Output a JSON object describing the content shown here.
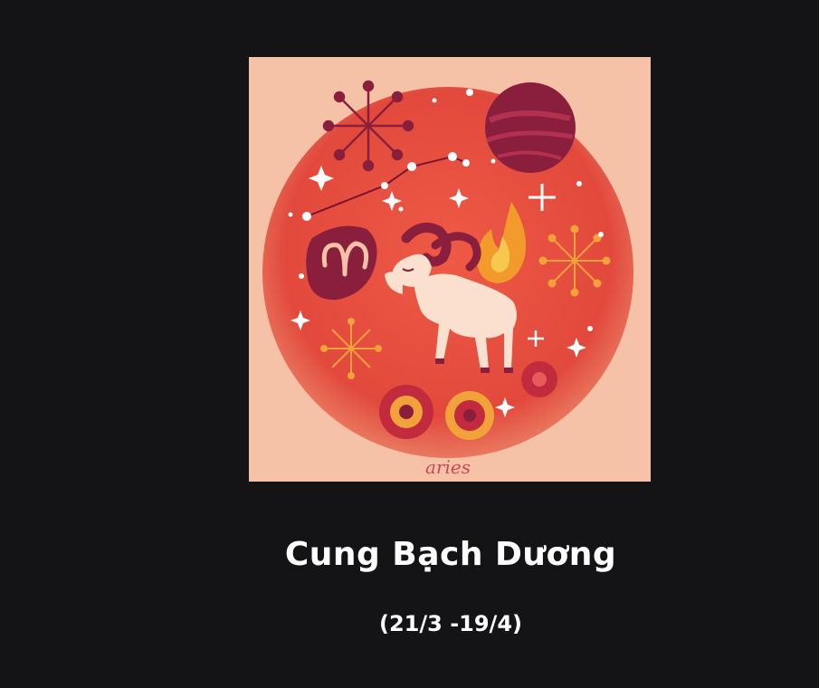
{
  "illustration": {
    "caption": "aries",
    "colors": {
      "background": "#f6c2a7",
      "disc": "#e8503f",
      "planet": "#8a1f3d",
      "accent": "#f2a23a",
      "ram": "#fbe0d0"
    }
  },
  "sign": {
    "name": "Cung Bạch Dương",
    "dates": "(21/3 -19/4)"
  }
}
